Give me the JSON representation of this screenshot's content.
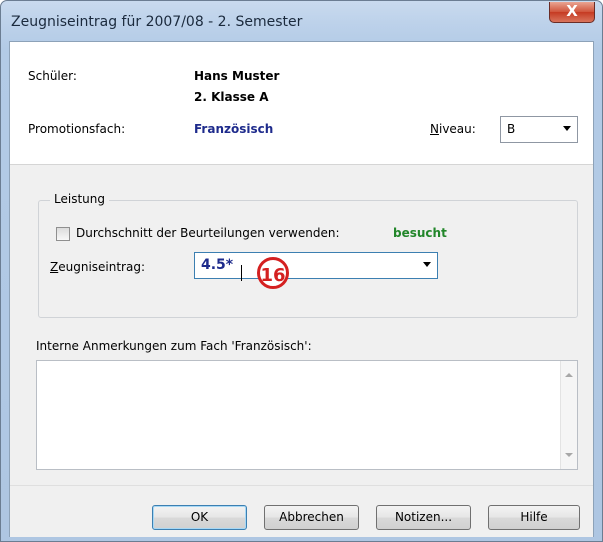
{
  "window": {
    "title": "Zeugniseintrag für 2007/08 - 2. Semester",
    "close_label": "X"
  },
  "student": {
    "label": "Schüler:",
    "name": "Hans Muster",
    "class": "2. Klasse A"
  },
  "subject": {
    "label": "Promotionsfach:",
    "value": "Französisch",
    "niveau_label_pre": "",
    "niveau_label_access": "N",
    "niveau_label_rest": "iveau:",
    "niveau_value": "B"
  },
  "leistung": {
    "title": "Leistung",
    "checkbox_label": "Durchschnitt der Beurteilungen verwenden:",
    "status": "besucht",
    "entry_label_access": "Z",
    "entry_label_rest": "eugniseintrag:",
    "entry_value": "4.5*",
    "callout": "16"
  },
  "notes": {
    "label": "Interne Anmerkungen zum Fach 'Französisch':",
    "value": ""
  },
  "buttons": {
    "ok": "OK",
    "cancel": "Abbrechen",
    "notes": "Notizen...",
    "help": "Hilfe"
  }
}
